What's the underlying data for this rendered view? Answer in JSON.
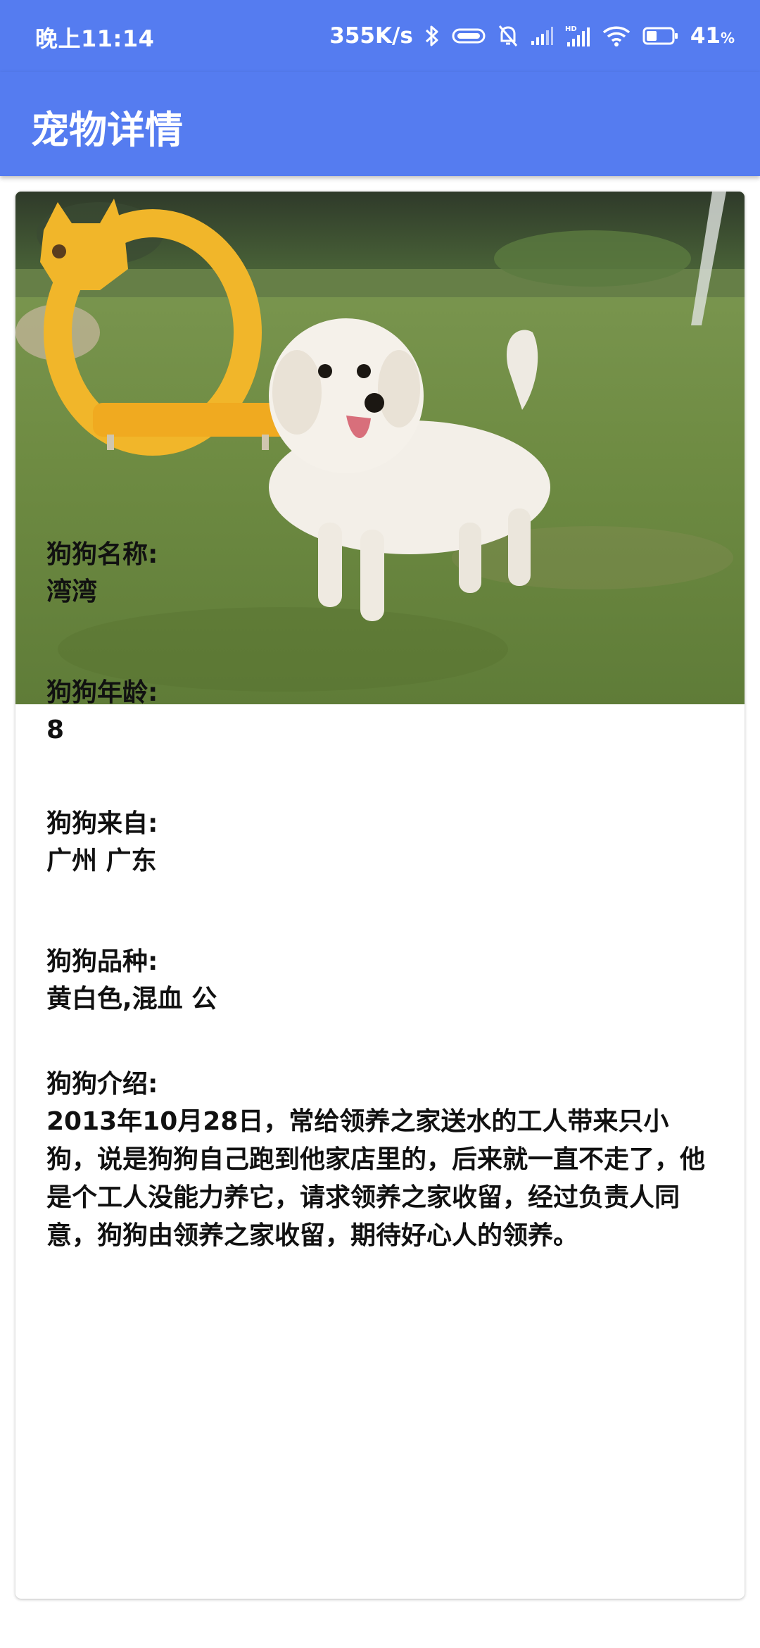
{
  "status_bar": {
    "time": "晚上11:14",
    "net_speed": "355K/s",
    "icons": [
      "bluetooth-icon",
      "vibrate-icon",
      "mute-bell-icon",
      "signal-icon",
      "hd-signal-icon",
      "wifi-icon",
      "battery-icon"
    ],
    "battery_level": 41,
    "battery_text": "41",
    "battery_unit": "%"
  },
  "app_bar": {
    "title": "宠物详情"
  },
  "pet": {
    "photo_icon": "dog-photo",
    "name_label": "狗狗名称:",
    "name": "湾湾",
    "age_label": "狗狗年龄:",
    "age": "8",
    "origin_label": "狗狗来自:",
    "origin": "广州 广东",
    "breed_label": "狗狗品种:",
    "breed": "黄白色,混血 公",
    "intro_label": "狗狗介绍:",
    "intro": "2013年10月28日，常给领养之家送水的工人带来只小狗，说是狗狗自己跑到他家店里的，后来就一直不走了，他是个工人没能力养它，请求领养之家收留，经过负责人同意，狗狗由领养之家收留，期待好心人的领养。"
  },
  "colors": {
    "primary": "#557cf0",
    "text": "#111111",
    "background": "#ffffff"
  }
}
